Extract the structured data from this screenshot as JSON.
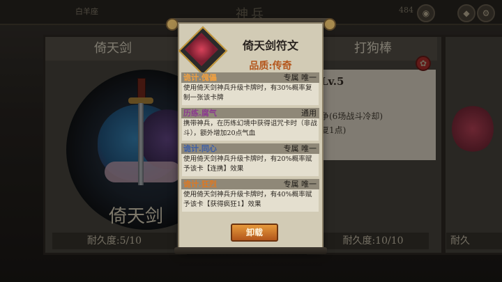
{
  "top_bar": {
    "left_stat": "白羊座",
    "title": "神兵",
    "right_stat": "484",
    "icons": [
      "coin-icon",
      "gem-icon",
      "settings-icon"
    ]
  },
  "background": {
    "left_card": {
      "name": "倚天剑",
      "big_name": "倚天剑",
      "durability": "耐久度:5/10"
    },
    "right_card": {
      "name": "打狗棒",
      "level": "Lv.5",
      "desc_line1": "争(6场战斗冷却)",
      "desc_line2": "复1点)",
      "durability": "耐久度:10/10"
    },
    "far_right_card": {
      "durability": "耐久"
    }
  },
  "popup": {
    "title": "倚天剑符文",
    "quality": "品质:传奇",
    "sections": [
      {
        "name": "诡计.傀儡",
        "tag": "专属 唯一",
        "name_color": "#f0a040",
        "desc": "使用倚天剑神兵升级卡牌时，有30%概率复制一张该卡牌"
      },
      {
        "name": "历练.腐气",
        "tag": "通用",
        "name_color": "#8b3a8f",
        "desc": "携带神兵，在历练幻境中获得诅咒卡时（非战斗），额外增加20点气血"
      },
      {
        "name": "诡计.同心",
        "tag": "专属 唯一",
        "name_color": "#3b5ea8",
        "desc": "使用倚天剑神兵升级卡牌时，有20%概率赋予该卡【连携】效果"
      },
      {
        "name": "诡计.狂烈",
        "tag": "专属 唯一",
        "name_color": "#e07820",
        "desc": "使用倚天剑神兵升级卡牌时，有40%概率赋予该卡【获得疯狂1】效果"
      }
    ],
    "unequip_label": "卸载"
  },
  "colors": {
    "accent_orange": "#b4561c",
    "button_orange": "#d47a2c",
    "parchment": "#d2cbb5"
  }
}
